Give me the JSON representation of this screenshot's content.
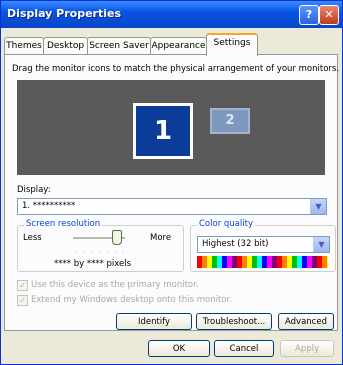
{
  "window": {
    "title": "Display Properties",
    "help_label": "?",
    "close_label": "✕"
  },
  "tabs": [
    {
      "label": "Themes",
      "active": false
    },
    {
      "label": "Desktop",
      "active": false
    },
    {
      "label": "Screen Saver",
      "active": false
    },
    {
      "label": "Appearance",
      "active": false
    },
    {
      "label": "Settings",
      "active": true
    }
  ],
  "instruction": "Drag the monitor icons to match the physical arrangement of your monitors.",
  "monitors": [
    {
      "label": "1",
      "selected": true
    },
    {
      "label": "2",
      "selected": false
    }
  ],
  "display": {
    "label": "Display:",
    "value": "1. **********"
  },
  "screen_resolution": {
    "title": "Screen resolution",
    "less_label": "Less",
    "more_label": "More",
    "ticks": "· · · · · · ·",
    "value_text": "**** by **** pixels",
    "slider_level": 0.85
  },
  "color_quality": {
    "title": "Color quality",
    "value": "Highest (32 bit)"
  },
  "checkboxes": [
    {
      "label": "Use this device as the primary monitor.",
      "checked": true,
      "disabled": true
    },
    {
      "label": "Extend my Windows desktop onto this monitor.",
      "checked": true,
      "disabled": true
    }
  ],
  "buttons": {
    "identify": "Identify",
    "troubleshoot": "Troubleshoot...",
    "advanced": "Advanced",
    "ok": "OK",
    "cancel": "Cancel",
    "apply": "Apply"
  },
  "colors": {
    "titlebar": "#0a55e3",
    "monitor_area": "#5a5a5a",
    "monitor_selected": "#0b3c9a",
    "group_title": "#0046d5"
  }
}
